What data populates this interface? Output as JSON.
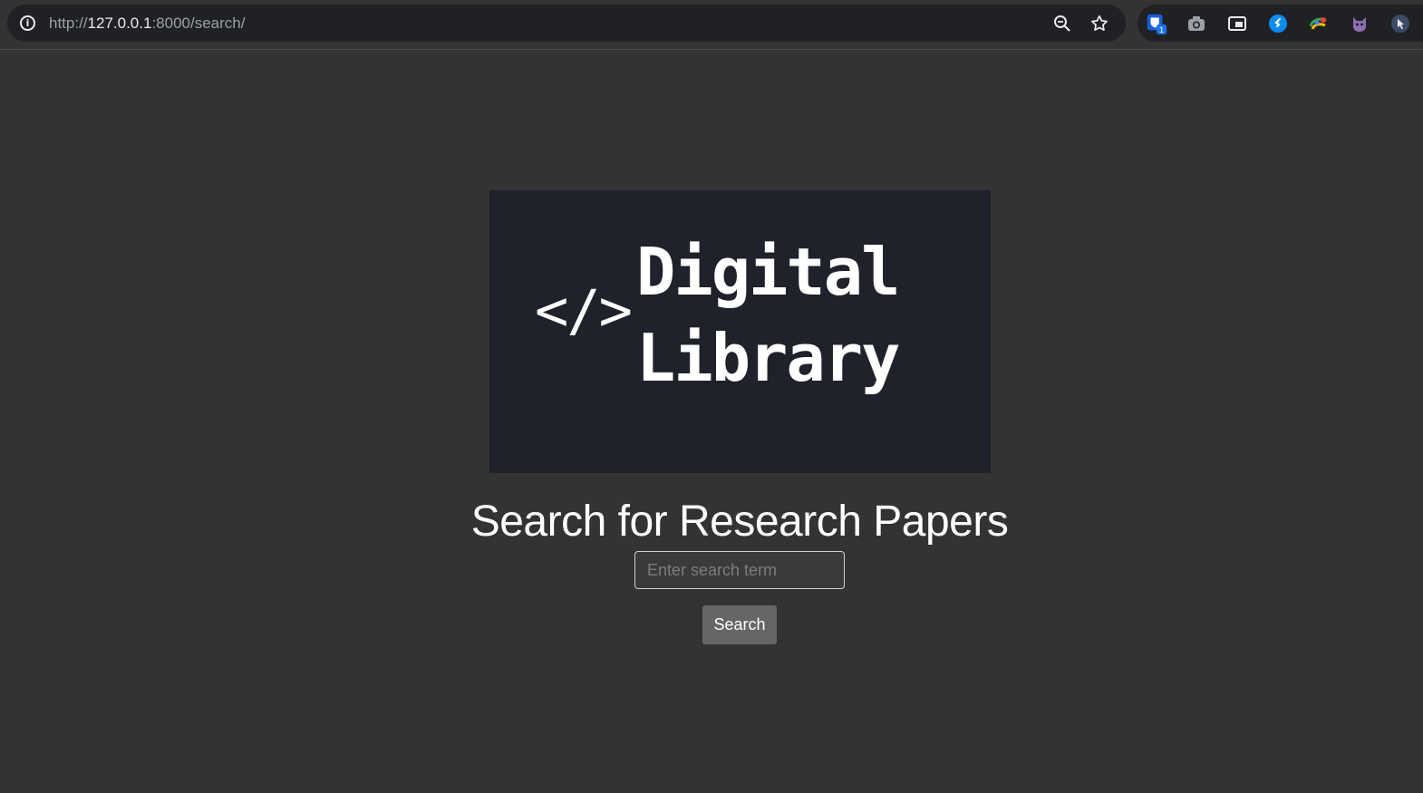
{
  "browser": {
    "url_scheme": "http://",
    "url_host": "127.0.0.1",
    "url_rest": ":8000/search/",
    "extension_badge": "1",
    "icons": [
      "info-icon",
      "zoom-icon",
      "star-icon",
      "bitwarden-icon",
      "camera-icon",
      "picture-in-picture-icon",
      "shazam-icon",
      "color-picker-icon",
      "cat-icon",
      "cursor-icon"
    ]
  },
  "logo": {
    "code": "</>",
    "line1": "Digital",
    "line2": "Library"
  },
  "main": {
    "heading": "Search for Research Papers",
    "search_placeholder": "Enter search term",
    "search_button": "Search"
  },
  "colors": {
    "page_bg": "#333333",
    "logo_bg": "#1f222b",
    "button_bg": "#666666"
  }
}
